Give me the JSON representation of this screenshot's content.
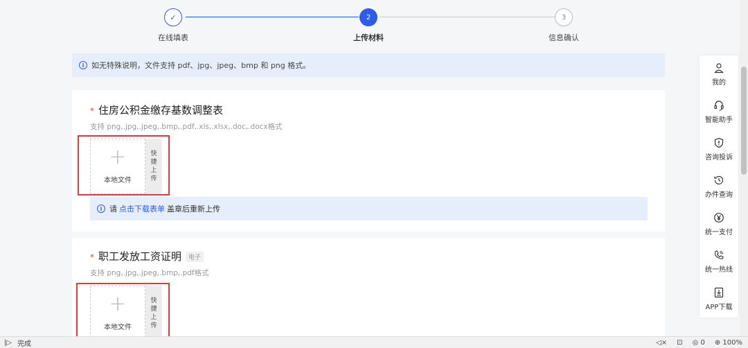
{
  "steps": [
    {
      "label": "在线填表",
      "mark": "✓",
      "state": "done"
    },
    {
      "label": "上传材料",
      "mark": "2",
      "state": "active"
    },
    {
      "label": "信息确认",
      "mark": "3",
      "state": "todo"
    }
  ],
  "info_bar": {
    "text": "如无特殊说明，文件支持 pdf、jpg、jpeg、bmp 和 png 格式。"
  },
  "cards": [
    {
      "title": "住房公积金缴存基数调整表",
      "required_mark": "*",
      "formats": "支持 png,.jpg,.jpeg,.bmp,.pdf,.xls,.xlsx,.doc,.docx格式",
      "local_upload": "本地文件",
      "quick_upload": [
        "快",
        "捷",
        "上",
        "传"
      ],
      "notice_prefix": "请",
      "notice_link": "点击下载表单",
      "notice_suffix": "盖章后重新上传"
    },
    {
      "title": "职工发放工资证明",
      "required_mark": "*",
      "tag": "电子",
      "formats": "支持 png,.jpg,.jpeg,.bmp,.pdf格式",
      "local_upload": "本地文件",
      "quick_upload": [
        "快",
        "捷",
        "上",
        "传"
      ]
    }
  ],
  "sidebar": [
    {
      "label": "我的",
      "icon": "user-icon"
    },
    {
      "label": "智能助手",
      "icon": "headset-icon"
    },
    {
      "label": "咨询投诉",
      "icon": "shield-alert-icon"
    },
    {
      "label": "办件查询",
      "icon": "history-icon"
    },
    {
      "label": "统一支付",
      "icon": "yen-icon"
    },
    {
      "label": "统一热线",
      "icon": "phone-icon"
    },
    {
      "label": "APP下载",
      "icon": "download-icon"
    }
  ],
  "statusbar": {
    "status": "完成",
    "zoom": "100%",
    "count": "0"
  },
  "colors": {
    "accent": "#2e5be8",
    "required": "#e0453a",
    "highlight": "#e23a3a"
  }
}
